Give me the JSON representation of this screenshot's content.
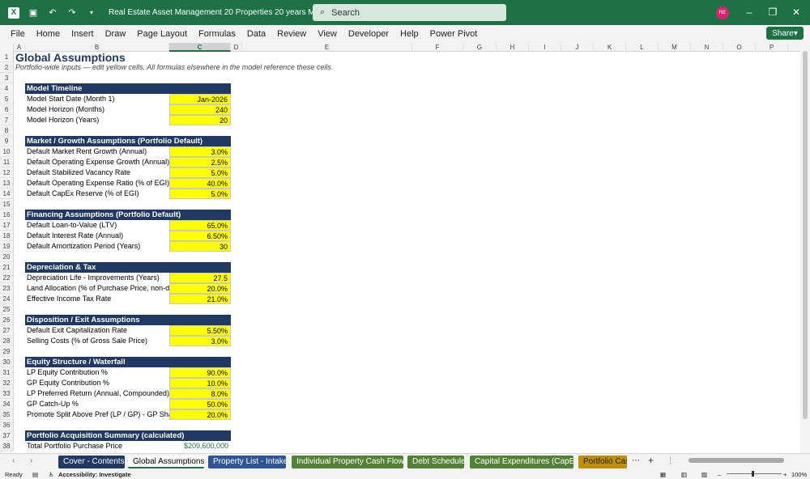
{
  "window": {
    "title": "Real Estate Asset Management 20 Properties  20 years Monthly.xlsx  -  E...",
    "search_placeholder": "Search",
    "user_initials": "RE"
  },
  "menu": [
    "File",
    "Home",
    "Insert",
    "Draw",
    "Page Layout",
    "Formulas",
    "Data",
    "Review",
    "View",
    "Developer",
    "Help",
    "Power Pivot"
  ],
  "share_label": "Share",
  "columns": [
    "A",
    "B",
    "C",
    "D",
    "E",
    "F",
    "G",
    "H",
    "I",
    "J",
    "K",
    "L",
    "M",
    "N",
    "O",
    "P"
  ],
  "selected_column": "C",
  "sheet": {
    "title": "Global Assumptions",
    "subtitle": "Portfolio-wide inputs — edit yellow cells. All formulas elsewhere in the model reference these cells.",
    "sections": [
      {
        "row": 4,
        "header": "Model Timeline",
        "items": [
          {
            "row": 5,
            "label": "Model Start Date (Month 1)",
            "value": "Jan-2026"
          },
          {
            "row": 6,
            "label": "Model Horizon (Months)",
            "value": "240"
          },
          {
            "row": 7,
            "label": "Model Horizon (Years)",
            "value": "20"
          }
        ]
      },
      {
        "row": 9,
        "header": "Market / Growth Assumptions (Portfolio Default)",
        "items": [
          {
            "row": 10,
            "label": "Default Market Rent Growth (Annual)",
            "value": "3.0%"
          },
          {
            "row": 11,
            "label": "Default Operating Expense Growth (Annual)",
            "value": "2.5%"
          },
          {
            "row": 12,
            "label": "Default Stabilized Vacancy Rate",
            "value": "5.0%"
          },
          {
            "row": 13,
            "label": "Default Operating Expense Ratio (% of EGI)",
            "value": "40.0%"
          },
          {
            "row": 14,
            "label": "Default CapEx Reserve (% of EGI)",
            "value": "5.0%"
          }
        ]
      },
      {
        "row": 16,
        "header": "Financing Assumptions (Portfolio Default)",
        "items": [
          {
            "row": 17,
            "label": "Default Loan-to-Value (LTV)",
            "value": "65.0%"
          },
          {
            "row": 18,
            "label": "Default Interest Rate (Annual)",
            "value": "6.50%"
          },
          {
            "row": 19,
            "label": "Default Amortization Period (Years)",
            "value": "30"
          }
        ]
      },
      {
        "row": 21,
        "header": "Depreciation & Tax",
        "items": [
          {
            "row": 22,
            "label": "Depreciation Life - Improvements (Years)",
            "value": "27.5"
          },
          {
            "row": 23,
            "label": "Land Allocation (% of Purchase Price, non-de",
            "value": "20.0%"
          },
          {
            "row": 24,
            "label": "Effective Income Tax Rate",
            "value": "21.0%"
          }
        ]
      },
      {
        "row": 26,
        "header": "Disposition / Exit Assumptions",
        "items": [
          {
            "row": 27,
            "label": "Default Exit Capitalization Rate",
            "value": "5.50%"
          },
          {
            "row": 28,
            "label": "Selling Costs (% of Gross Sale Price)",
            "value": "3.0%"
          }
        ]
      },
      {
        "row": 30,
        "header": "Equity Structure / Waterfall",
        "items": [
          {
            "row": 31,
            "label": "LP Equity Contribution %",
            "value": "90.0%"
          },
          {
            "row": 32,
            "label": "GP Equity Contribution %",
            "value": "10.0%"
          },
          {
            "row": 33,
            "label": "LP Preferred Return (Annual, Compounded)",
            "value": "8.0%"
          },
          {
            "row": 34,
            "label": "GP Catch-Up %",
            "value": "50.0%"
          },
          {
            "row": 35,
            "label": "Promote Split Above Pref (LP / GP) - GP Shar",
            "value": "20.0%"
          }
        ]
      },
      {
        "row": 37,
        "header": "Portfolio Acquisition Summary (calculated)",
        "items": [
          {
            "row": 38,
            "label": "Total Portfolio Purchase Price",
            "value": "$209,600,000",
            "calc": true
          }
        ]
      }
    ]
  },
  "tabs": [
    {
      "label": "Cover - Contents",
      "color": "#1f3864"
    },
    {
      "label": "Global Assumptions",
      "color": "#ffffff",
      "active": true
    },
    {
      "label": "Property List - Intake",
      "color": "#2e5597"
    },
    {
      "label": "Individual Property Cash Flows",
      "color": "#548235"
    },
    {
      "label": "Debt Schedule",
      "color": "#548235"
    },
    {
      "label": "Capital Expenditures (CapEx)",
      "color": "#548235"
    },
    {
      "label": "Portfolio Cas",
      "color": "#bf8f00"
    }
  ],
  "status": {
    "ready": "Ready",
    "accessibility": "Accessibility: Investigate",
    "zoom": "100%"
  }
}
